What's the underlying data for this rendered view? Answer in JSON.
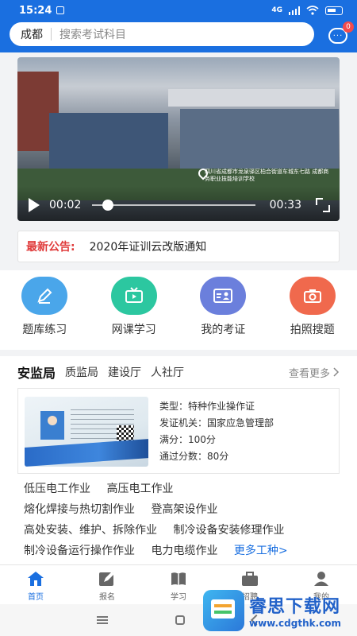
{
  "status_bar": {
    "time": "15:24",
    "network": "4G"
  },
  "header": {
    "city": "成都",
    "search_placeholder": "搜索考试科目",
    "message_badge": "0"
  },
  "video": {
    "current_time": "00:02",
    "duration": "00:33",
    "progress": 0.06,
    "caption": "四川省成都市龙泉驿区柏合街道车城东七路 成都商务职业技能培训学校"
  },
  "notice": {
    "tag": "最新公告:",
    "text": "2020年证训云改版通知"
  },
  "quick_actions": [
    {
      "label": "题库练习",
      "icon": "pencil-icon",
      "color": "#4aa6ea"
    },
    {
      "label": "网课学习",
      "icon": "tv-icon",
      "color": "#2cc7a0"
    },
    {
      "label": "我的考证",
      "icon": "id-card-icon",
      "color": "#6b7fdc"
    },
    {
      "label": "拍照搜题",
      "icon": "camera-icon",
      "color": "#f0694d"
    }
  ],
  "category": {
    "tabs": [
      "安监局",
      "质监局",
      "建设厅",
      "人社厅"
    ],
    "more_label": "查看更多",
    "cert": {
      "type": "类型：特种作业操作证",
      "issuer": "发证机关：国家应急管理部",
      "full_score": "满分：100分",
      "pass_score": "通过分数：80分"
    },
    "jobs": [
      "低压电工作业",
      "高压电工作业",
      "熔化焊接与热切割作业",
      "登高架设作业",
      "高处安装、维护、拆除作业",
      "制冷设备安装修理作业",
      "制冷设备运行操作作业",
      "电力电缆作业"
    ],
    "jobs_more": "更多工种>"
  },
  "bottom_nav": [
    {
      "label": "首页",
      "icon": "home-icon",
      "active": true
    },
    {
      "label": "报名",
      "icon": "edit-icon",
      "active": false
    },
    {
      "label": "学习",
      "icon": "book-icon",
      "active": false
    },
    {
      "label": "招聘",
      "icon": "briefcase-icon",
      "active": false
    },
    {
      "label": "我的",
      "icon": "user-icon",
      "active": false
    }
  ],
  "watermark": {
    "name": "睿思下载网",
    "url": "www.cdgthk.com"
  },
  "colors": {
    "primary": "#1a6fe0",
    "notice_red": "#e03c3c"
  }
}
